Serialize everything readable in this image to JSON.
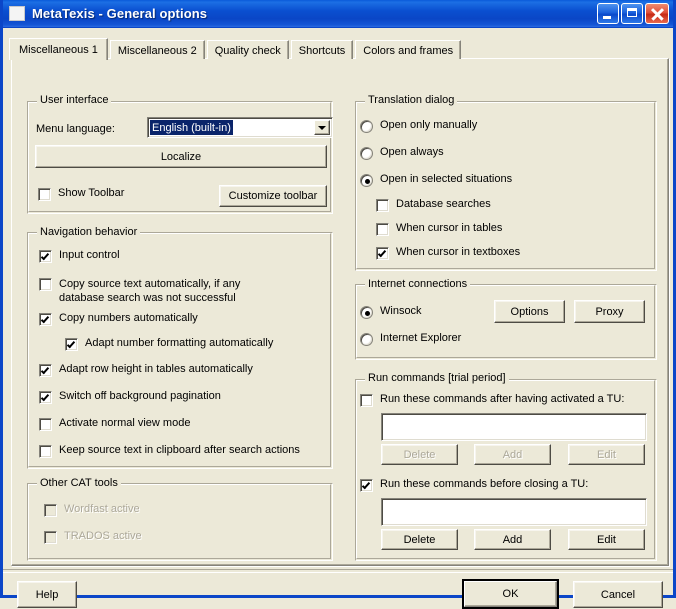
{
  "window": {
    "title": "MetaTexis - General options",
    "icon": "app-icon",
    "buttons": {
      "minimize": "minimize-button",
      "maximize": "maximize-button",
      "close": "close-button"
    },
    "accent_title_color": "#0a4fd0",
    "face_color": "#ece9d8",
    "close_color": "#c52a16"
  },
  "tabs": [
    {
      "label": "Miscellaneous 1",
      "active": true
    },
    {
      "label": "Miscellaneous 2",
      "active": false
    },
    {
      "label": "Quality check",
      "active": false
    },
    {
      "label": "Shortcuts",
      "active": false
    },
    {
      "label": "Colors and frames",
      "active": false
    }
  ],
  "user_interface": {
    "group_title": "User interface",
    "menu_language_label": "Menu language:",
    "menu_language_value": "English (built-in)",
    "localize_button": "Localize",
    "show_toolbar_label": "Show Toolbar",
    "show_toolbar_checked": false,
    "customize_toolbar_button": "Customize toolbar"
  },
  "navigation_behavior": {
    "group_title": "Navigation behavior",
    "items": [
      {
        "label": "Input control",
        "checked": true,
        "indent": false
      },
      {
        "label": "Copy source text automatically, if any\ndatabase search was not successful",
        "checked": false,
        "indent": false
      },
      {
        "label": "Copy numbers automatically",
        "checked": true,
        "indent": false
      },
      {
        "label": "Adapt number formatting automatically",
        "checked": true,
        "indent": true
      },
      {
        "label": "Adapt row height in tables automatically",
        "checked": true,
        "indent": false
      },
      {
        "label": "Switch off background pagination",
        "checked": true,
        "indent": false
      },
      {
        "label": "Activate normal view mode",
        "checked": false,
        "indent": false
      },
      {
        "label": "Keep source text in clipboard after search actions",
        "checked": false,
        "indent": false
      }
    ]
  },
  "other_cat_tools": {
    "group_title": "Other CAT tools",
    "items": [
      {
        "label": "Wordfast active",
        "checked": false,
        "disabled": true
      },
      {
        "label": "TRADOS active",
        "checked": false,
        "disabled": true
      }
    ]
  },
  "translation_dialog": {
    "group_title": "Translation dialog",
    "options": [
      {
        "label": "Open only manually",
        "selected": false
      },
      {
        "label": "Open always",
        "selected": false
      },
      {
        "label": "Open in selected situations",
        "selected": true
      }
    ],
    "sub_options": [
      {
        "label": "Database searches",
        "checked": false
      },
      {
        "label": "When cursor in tables",
        "checked": false
      },
      {
        "label": "When cursor in textboxes",
        "checked": true
      }
    ]
  },
  "internet_connections": {
    "group_title": "Internet connections",
    "options": [
      {
        "label": "Winsock",
        "selected": true
      },
      {
        "label": "Internet Explorer",
        "selected": false
      }
    ],
    "options_button": "Options",
    "proxy_button": "Proxy"
  },
  "run_commands": {
    "group_title": "Run commands [trial period]",
    "after_activate": {
      "label": "Run these commands after having activated a TU:",
      "checked": false,
      "field_value": "",
      "buttons": [
        {
          "label": "Delete",
          "disabled": true
        },
        {
          "label": "Add",
          "disabled": true
        },
        {
          "label": "Edit",
          "disabled": true
        }
      ]
    },
    "before_closing": {
      "label": "Run these commands before closing a TU:",
      "checked": true,
      "field_value": "",
      "buttons": [
        {
          "label": "Delete",
          "disabled": false
        },
        {
          "label": "Add",
          "disabled": false
        },
        {
          "label": "Edit",
          "disabled": false
        }
      ]
    }
  },
  "footer": {
    "help_button": "Help",
    "ok_button": "OK",
    "cancel_button": "Cancel"
  }
}
